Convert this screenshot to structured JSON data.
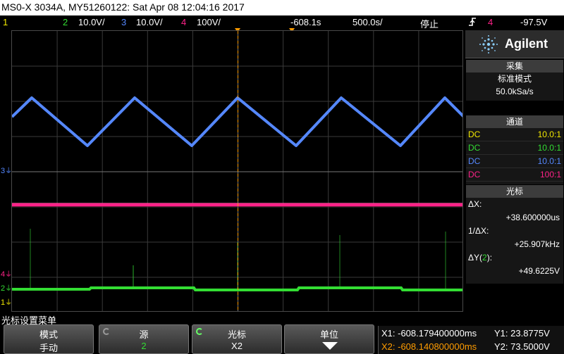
{
  "title": "MS0-X 3034A, MY51260122: Sat Apr 08 12:04:16 2017",
  "status": {
    "ch1_num": "1",
    "ch2_num": "2",
    "ch2_scale": "10.0V/",
    "ch3_num": "3",
    "ch3_scale": "10.0V/",
    "ch4_num": "4",
    "ch4_scale": "100V/",
    "time_offset": "-608.1s",
    "time_scale": "500.0s/",
    "run_state": "停止",
    "trigger_icon": "trigger-edge-icon",
    "trigger_ch": "4",
    "trigger_level": "-97.5V"
  },
  "colors": {
    "ch1": "#f2e800",
    "ch2": "#33dd33",
    "ch3": "#5588ff",
    "ch4": "#ff2288",
    "cursor": "#ff9c00"
  },
  "panel": {
    "brand": "Agilent",
    "acq_title": "采集",
    "acq_mode": "标准模式",
    "acq_rate": "50.0kSa/s",
    "ch_title": "通道",
    "channels": [
      {
        "coupling": "DC",
        "probe": "10.0:1"
      },
      {
        "coupling": "DC",
        "probe": "10.0:1"
      },
      {
        "coupling": "DC",
        "probe": "10.0:1"
      },
      {
        "coupling": "DC",
        "probe": "100:1"
      }
    ],
    "cursor_title": "光标",
    "dx_label": "ΔX:",
    "dx_value": "+38.600000us",
    "inv_dx_label": "1/ΔX:",
    "inv_dx_value": "+25.907kHz",
    "dy_label_pre": "ΔY(",
    "dy_label_ch": "2",
    "dy_label_post": "):",
    "dy_value": "+49.6225V"
  },
  "markers": {
    "ch3": "3",
    "ch4": "4",
    "ch2": "2",
    "ch1": "1"
  },
  "menu": {
    "title": "光标设置菜单",
    "keys": [
      {
        "label": "模式",
        "value": "手动"
      },
      {
        "label": "源",
        "value": "2"
      },
      {
        "label": "光标",
        "value": "X2"
      },
      {
        "label": "单位",
        "value": ""
      }
    ]
  },
  "cursors": {
    "x1": "X1: -608.179400000ms",
    "y1": "Y1: 23.8775V",
    "x2": "X2: -608.140800000ms",
    "y2": "Y2: 73.5000V"
  }
}
